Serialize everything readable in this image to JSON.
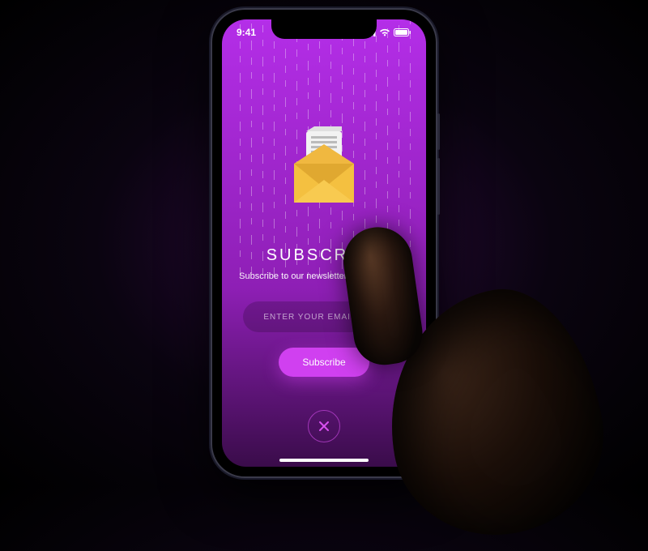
{
  "status": {
    "time": "9:41"
  },
  "heading": {
    "title": "SUBSCRIBE",
    "subtitle": "Subscribe to our newsletter & stay updated"
  },
  "form": {
    "email_placeholder": "ENTER YOUR EMAIL HERE",
    "submit_label": "Subscribe"
  },
  "colors": {
    "accent": "#d040f0",
    "bg_top": "#b42ee8",
    "bg_bottom": "#3a0c4a"
  }
}
